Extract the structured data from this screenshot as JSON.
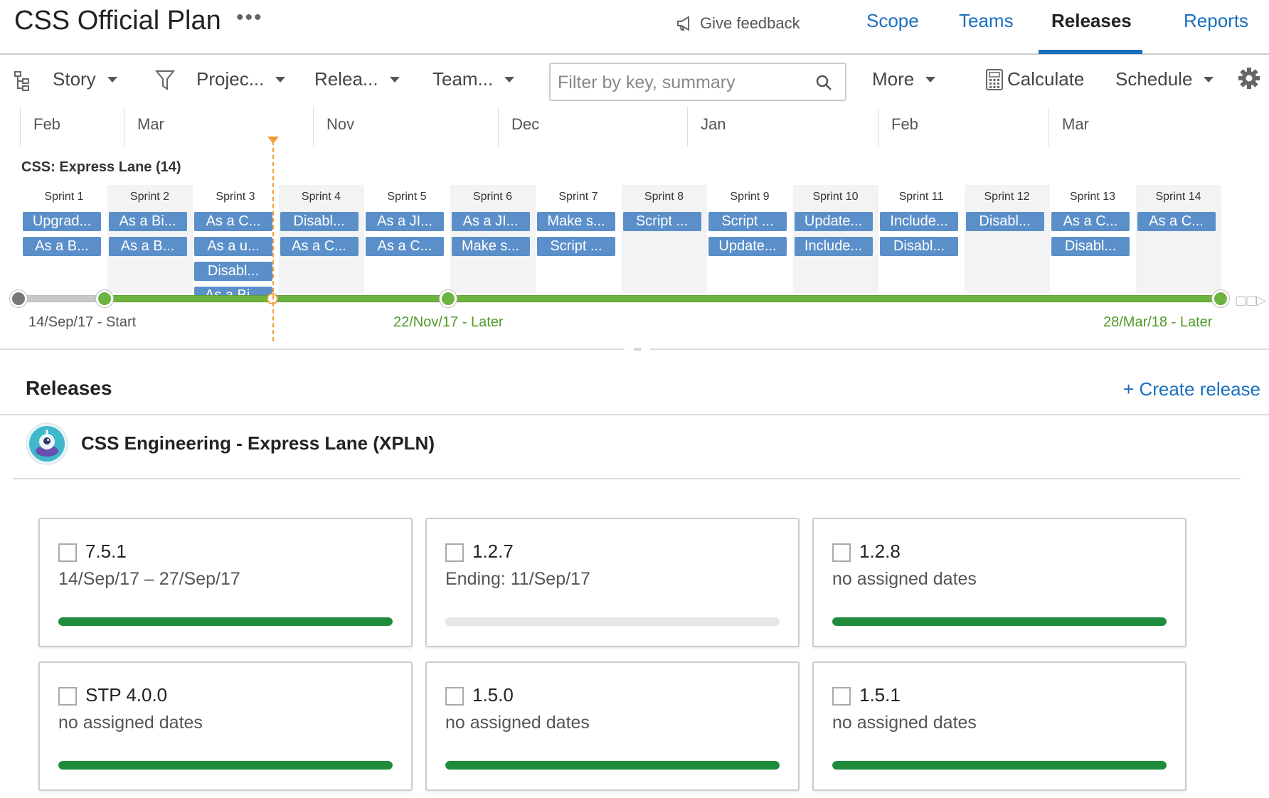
{
  "header": {
    "plan_title": "CSS Official Plan",
    "more_label": "•••",
    "feedback_label": "Give feedback",
    "tabs": [
      {
        "label": "Scope"
      },
      {
        "label": "Teams"
      },
      {
        "label": "Releases"
      },
      {
        "label": "Reports"
      }
    ],
    "active_tab": "Releases"
  },
  "toolbar": {
    "story_label": "Story",
    "project_label": "Projec...",
    "release_label": "Relea...",
    "team_label": "Team...",
    "search_placeholder": "Filter by key, summary",
    "more_label": "More",
    "calculate_label": "Calculate",
    "schedule_label": "Schedule"
  },
  "timeline": {
    "months": [
      "Feb",
      "Mar",
      "Nov",
      "Dec",
      "Jan",
      "Feb",
      "Mar"
    ],
    "lane_title": "CSS: Express Lane (14)",
    "sprints": [
      {
        "name": "Sprint 1",
        "issues": [
          "Upgrad...",
          "As a B..."
        ]
      },
      {
        "name": "Sprint 2",
        "issues": [
          "As a Bi...",
          "As a B..."
        ]
      },
      {
        "name": "Sprint 3",
        "issues": [
          "As a C...",
          "As a u...",
          "Disabl...",
          "As a Bi..."
        ]
      },
      {
        "name": "Sprint 4",
        "issues": [
          "Disabl...",
          "As a C..."
        ]
      },
      {
        "name": "Sprint 5",
        "issues": [
          "As a JI...",
          "As a C..."
        ]
      },
      {
        "name": "Sprint 6",
        "issues": [
          "As a JI...",
          "Make s..."
        ]
      },
      {
        "name": "Sprint 7",
        "issues": [
          "Make s...",
          "Script ..."
        ]
      },
      {
        "name": "Sprint 8",
        "issues": [
          "Script ..."
        ]
      },
      {
        "name": "Sprint 9",
        "issues": [
          "Script ...",
          "Update..."
        ]
      },
      {
        "name": "Sprint 10",
        "issues": [
          "Update...",
          "Include..."
        ]
      },
      {
        "name": "Sprint 11",
        "issues": [
          "Include...",
          "Disabl..."
        ]
      },
      {
        "name": "Sprint 12",
        "issues": [
          "Disabl..."
        ]
      },
      {
        "name": "Sprint 13",
        "issues": [
          "As a C...",
          "Disabl..."
        ]
      },
      {
        "name": "Sprint 14",
        "issues": [
          "As a C..."
        ]
      }
    ],
    "start_label": "14/Sep/17 - Start",
    "mid_label": "22/Nov/17 - Later",
    "end_label": "28/Mar/18 - Later"
  },
  "releases": {
    "title": "Releases",
    "create_label": "+ Create release",
    "project_name": "CSS Engineering - Express Lane (XPLN)",
    "cards": [
      {
        "name": "7.5.1",
        "dates": "14/Sep/17 – 27/Sep/17",
        "progress": 1.0
      },
      {
        "name": "1.2.7",
        "dates": "Ending: 11/Sep/17",
        "progress": 0.0
      },
      {
        "name": "1.2.8",
        "dates": "no assigned dates",
        "progress": 1.0
      },
      {
        "name": "STP 4.0.0",
        "dates": "no assigned dates",
        "progress": 1.0
      },
      {
        "name": "1.5.0",
        "dates": "no assigned dates",
        "progress": 1.0
      },
      {
        "name": "1.5.1",
        "dates": "no assigned dates",
        "progress": 1.0
      }
    ]
  },
  "colors": {
    "accent": "#1a6fc0",
    "issue": "#5b8fc9",
    "progress": "#1f8c3b",
    "track": "#6cb33f",
    "today": "#f29c35"
  }
}
